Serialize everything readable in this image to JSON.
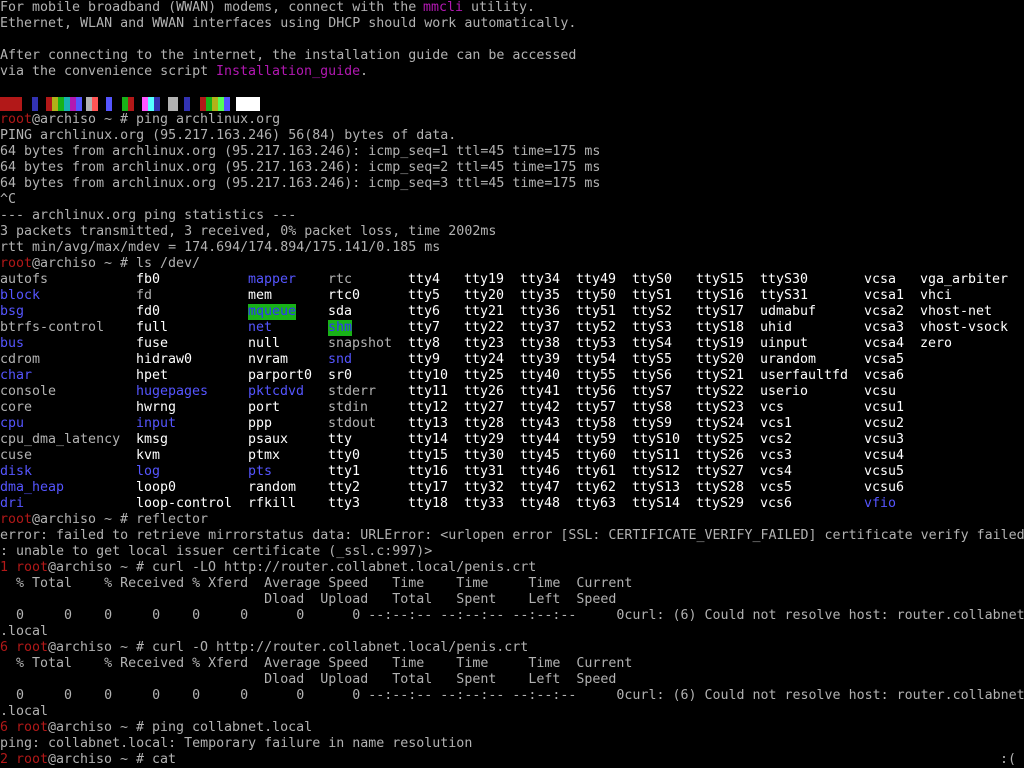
{
  "colors": {
    "background": "#000000",
    "text": "#b2b2b2",
    "prompt_user": "#b21818",
    "link": "#b218b2",
    "dir": "#5555ff",
    "device": "#ffff55",
    "white": "#ffffff",
    "highlight_bg": "#18b218"
  },
  "intro": {
    "line1_before": "For mobile broadband (WWAN) modems, connect with the ",
    "line1_link": "mmcli",
    "line1_after": " utility.",
    "line2": "Ethernet, WLAN and WWAN interfaces using DHCP should work automatically.",
    "line3_blank": "",
    "line4": "After connecting to the internet, the installation guide can be accessed",
    "line5_before": "via the convenience script ",
    "line5_link": "Installation_guide",
    "line5_after": ".",
    "line6_blank": ""
  },
  "prompt": {
    "user": "root",
    "host": "@archiso",
    "suffix": " ~ # "
  },
  "commands": {
    "ping1": "ping archlinux.org",
    "ls": "ls /dev/",
    "reflector": "reflector",
    "curl1": "curl -LO http://router.collabnet.local/penis.crt",
    "curl2": "curl -O http://router.collabnet.local/penis.crt",
    "ping2": "ping collabnet.local",
    "cat": "cat"
  },
  "ping_output": [
    "PING archlinux.org (95.217.163.246) 56(84) bytes of data.",
    "64 bytes from archlinux.org (95.217.163.246): icmp_seq=1 ttl=45 time=175 ms",
    "64 bytes from archlinux.org (95.217.163.246): icmp_seq=2 ttl=45 time=175 ms",
    "64 bytes from archlinux.org (95.217.163.246): icmp_seq=3 ttl=45 time=175 ms",
    "^C",
    "--- archlinux.org ping statistics ---",
    "3 packets transmitted, 3 received, 0% packet loss, time 2002ms",
    "rtt min/avg/max/mdev = 174.694/174.894/175.141/0.185 ms"
  ],
  "ls_columns": [
    [
      "autofs",
      "block",
      "bsg",
      "btrfs-control",
      "bus",
      "cdrom",
      "char",
      "console",
      "core",
      "cpu",
      "cpu_dma_latency",
      "cuse",
      "disk",
      "dma_heap",
      "dri"
    ],
    [
      "fb0",
      "fd",
      "fd0",
      "full",
      "fuse",
      "hidraw0",
      "hpet",
      "hugepages",
      "hwrng",
      "input",
      "kmsg",
      "kvm",
      "log",
      "loop0",
      "loop-control"
    ],
    [
      "mapper",
      "mem",
      "mqueue",
      "net",
      "null",
      "nvram",
      "parport0",
      "pktcdvd",
      "port",
      "ppp",
      "psaux",
      "ptmx",
      "pts",
      "random",
      "rfkill"
    ],
    [
      "rtc",
      "rtc0",
      "sda",
      "shm",
      "snapshot",
      "snd",
      "sr0",
      "stderr",
      "stdin",
      "stdout",
      "tty",
      "tty0",
      "tty1",
      "tty2",
      "tty3"
    ],
    [
      "tty4",
      "tty5",
      "tty6",
      "tty7",
      "tty8",
      "tty9",
      "tty10",
      "tty11",
      "tty12",
      "tty13",
      "tty14",
      "tty15",
      "tty16",
      "tty17",
      "tty18"
    ],
    [
      "tty19",
      "tty20",
      "tty21",
      "tty22",
      "tty23",
      "tty24",
      "tty25",
      "tty26",
      "tty27",
      "tty28",
      "tty29",
      "tty30",
      "tty31",
      "tty32",
      "tty33"
    ],
    [
      "tty34",
      "tty35",
      "tty36",
      "tty37",
      "tty38",
      "tty39",
      "tty40",
      "tty41",
      "tty42",
      "tty43",
      "tty44",
      "tty45",
      "tty46",
      "tty47",
      "tty48"
    ],
    [
      "tty49",
      "tty50",
      "tty51",
      "tty52",
      "tty53",
      "tty54",
      "tty55",
      "tty56",
      "tty57",
      "tty58",
      "tty59",
      "tty60",
      "tty61",
      "tty62",
      "tty63"
    ],
    [
      "ttyS0",
      "ttyS1",
      "ttyS2",
      "ttyS3",
      "ttyS4",
      "ttyS5",
      "ttyS6",
      "ttyS7",
      "ttyS8",
      "ttyS9",
      "ttyS10",
      "ttyS11",
      "ttyS12",
      "ttyS13",
      "ttyS14"
    ],
    [
      "ttyS15",
      "ttyS16",
      "ttyS17",
      "ttyS18",
      "ttyS19",
      "ttyS20",
      "ttyS21",
      "ttyS22",
      "ttyS23",
      "ttyS24",
      "ttyS25",
      "ttyS26",
      "ttyS27",
      "ttyS28",
      "ttyS29"
    ],
    [
      "ttyS30",
      "ttyS31",
      "udmabuf",
      "uhid",
      "uinput",
      "urandom",
      "userfaultfd",
      "userio",
      "vcs",
      "vcs1",
      "vcs2",
      "vcs3",
      "vcs4",
      "vcs5",
      "vcs6"
    ],
    [
      "vcsa",
      "vcsa1",
      "vcsa2",
      "vcsa3",
      "vcsa4",
      "vcsa5",
      "vcsa6",
      "vcsu",
      "vcsu1",
      "vcsu2",
      "vcsu3",
      "vcsu4",
      "vcsu5",
      "vcsu6",
      "vfio"
    ],
    [
      "vga_arbiter",
      "vhci",
      "vhost-net",
      "vhost-vsock",
      "zero"
    ]
  ],
  "ls_blue_entries": [
    "block",
    "bsg",
    "bus",
    "char",
    "cpu",
    "disk",
    "dma_heap",
    "dri",
    "input",
    "hugepages",
    "log",
    "mapper",
    "net",
    "pktcdvd",
    "pts",
    "snd",
    "vfio"
  ],
  "ls_highlighted_entries": [
    "mqueue",
    "shm"
  ],
  "ls_yellow_entries": [
    "fb0",
    "fd0",
    "full",
    "fuse",
    "hidraw0",
    "hpet",
    "hwrng",
    "kmsg",
    "kvm",
    "loop0",
    "loop-control",
    "mem",
    "null",
    "nvram",
    "parport0",
    "port",
    "ppp",
    "psaux",
    "ptmx",
    "random",
    "rfkill",
    "rtc0",
    "sda",
    "sr0",
    "tty",
    "tty0",
    "tty1",
    "tty2",
    "tty3",
    "tty4",
    "tty5",
    "tty6",
    "tty7",
    "tty8",
    "tty9",
    "tty10",
    "tty11",
    "tty12",
    "tty13",
    "tty14",
    "tty15",
    "tty16",
    "tty17",
    "tty18",
    "tty19",
    "tty20",
    "tty21",
    "tty22",
    "tty23",
    "tty24",
    "tty25",
    "tty26",
    "tty27",
    "tty28",
    "tty29",
    "tty30",
    "tty31",
    "tty32",
    "tty33",
    "tty34",
    "tty35",
    "tty36",
    "tty37",
    "tty38",
    "tty39",
    "tty40",
    "tty41",
    "tty42",
    "tty43",
    "tty44",
    "tty45",
    "tty46",
    "tty47",
    "tty48",
    "tty49",
    "tty50",
    "tty51",
    "tty52",
    "tty53",
    "tty54",
    "tty55",
    "tty56",
    "tty57",
    "tty58",
    "tty59",
    "tty60",
    "tty61",
    "tty62",
    "tty63",
    "ttyS0",
    "ttyS1",
    "ttyS2",
    "ttyS3",
    "ttyS4",
    "ttyS5",
    "ttyS6",
    "ttyS7",
    "ttyS8",
    "ttyS9",
    "ttyS10",
    "ttyS11",
    "ttyS12",
    "ttyS13",
    "ttyS14",
    "ttyS15",
    "ttyS16",
    "ttyS17",
    "ttyS18",
    "ttyS19",
    "ttyS20",
    "ttyS21",
    "ttyS22",
    "ttyS23",
    "ttyS24",
    "ttyS25",
    "ttyS26",
    "ttyS27",
    "ttyS28",
    "ttyS29",
    "ttyS30",
    "ttyS31",
    "udmabuf",
    "uhid",
    "uinput",
    "urandom",
    "userfaultfd",
    "userio",
    "vcs",
    "vcs1",
    "vcs2",
    "vcs3",
    "vcs4",
    "vcs5",
    "vcs6",
    "vcsa",
    "vcsa1",
    "vcsa2",
    "vcsa3",
    "vcsa4",
    "vcsa5",
    "vcsa6",
    "vcsu",
    "vcsu1",
    "vcsu2",
    "vcsu3",
    "vcsu4",
    "vcsu5",
    "vcsu6",
    "vga_arbiter",
    "vhci",
    "vhost-net",
    "vhost-vsock",
    "zero"
  ],
  "reflector_output": [
    "error: failed to retrieve mirrorstatus data: URLError: <urlopen error [SSL: CERTIFICATE_VERIFY_FAILED] certificate verify failed",
    ": unable to get local issuer certificate (_ssl.c:997)>"
  ],
  "curl1": {
    "exit_code": "1",
    "header1": "  % Total    % Received % Xferd  Average Speed   Time    Time     Time  Current",
    "header2": "                                 Dload  Upload   Total   Spent    Left  Speed",
    "progress": "  0     0    0     0    0     0      0      0 --:--:-- --:--:-- --:--:--     0curl: (6) Could not resolve host: router.collabnet",
    "wrap": ".local"
  },
  "curl2": {
    "exit_code": "6",
    "header1": "  % Total    % Received % Xferd  Average Speed   Time    Time     Time  Current",
    "header2": "                                 Dload  Upload   Total   Spent    Left  Speed",
    "progress": "  0     0    0     0    0     0      0      0 --:--:-- --:--:-- --:--:--     0curl: (6) Could not resolve host: router.collabnet",
    "wrap": ".local"
  },
  "ping2_output": "ping: collabnet.local: Temporary failure in name resolution",
  "ping2_exit_code": "2",
  "status_face": ":("
}
